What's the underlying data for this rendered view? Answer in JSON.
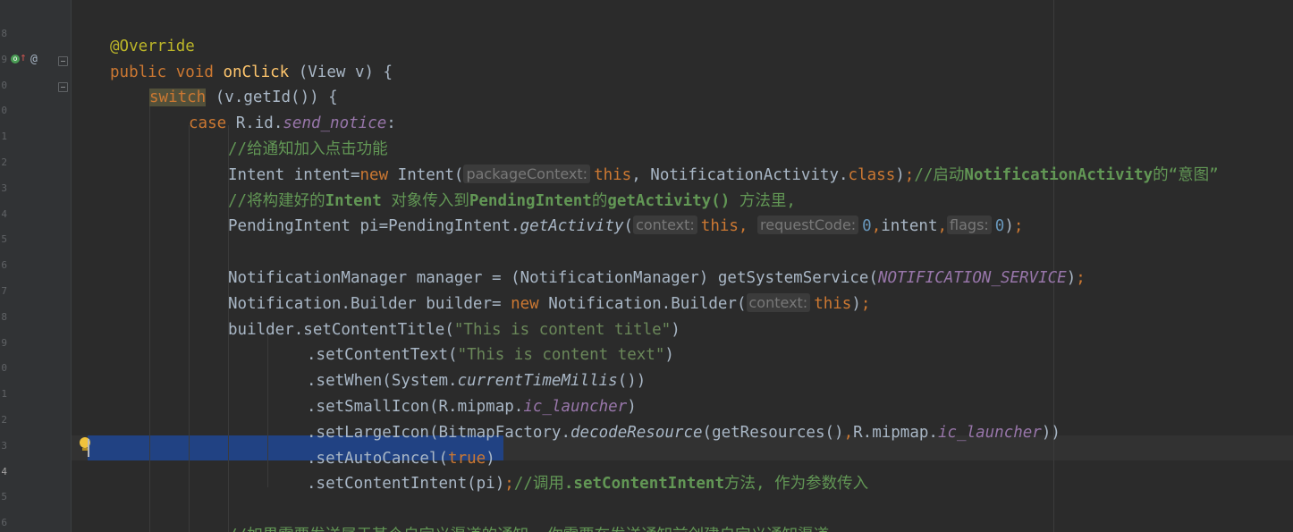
{
  "gutter": {
    "line_numbers": [
      "8",
      "9",
      "0",
      "0",
      "1",
      "2",
      "3",
      "4",
      "5",
      "6",
      "7",
      "8",
      "9",
      "0",
      "1",
      "2",
      "3",
      "4",
      "5",
      "6",
      "7"
    ],
    "override_marker": "o",
    "implements_marker": "↑",
    "annotation_marker": "@",
    "current_line_index": 17
  },
  "code": {
    "lines": [
      {
        "indent": 0,
        "tokens": []
      },
      {
        "indent": 0,
        "tokens": [
          {
            "t": "ann",
            "v": "@Override"
          }
        ]
      },
      {
        "indent": 0,
        "tokens": [
          {
            "t": "kw",
            "v": "public void "
          },
          {
            "t": "fn",
            "v": "onClick"
          },
          {
            "t": "def",
            "v": " (View v) {"
          }
        ]
      },
      {
        "indent": 1,
        "tokens": [
          {
            "t": "kw-switch",
            "v": "switch"
          },
          {
            "t": "def",
            "v": " (v.getId()) {"
          }
        ]
      },
      {
        "indent": 2,
        "tokens": [
          {
            "t": "kw",
            "v": "case "
          },
          {
            "t": "def",
            "v": "R.id."
          },
          {
            "t": "field",
            "v": "send_notice"
          },
          {
            "t": "def",
            "v": ":"
          }
        ]
      },
      {
        "indent": 3,
        "tokens": [
          {
            "t": "cmt",
            "v": "//给通知加入点击功能"
          }
        ]
      },
      {
        "indent": 3,
        "tokens": [
          {
            "t": "def",
            "v": "Intent intent="
          },
          {
            "t": "kw",
            "v": "new "
          },
          {
            "t": "def",
            "v": "Intent("
          },
          {
            "t": "hint",
            "v": "packageContext:"
          },
          {
            "t": "kw",
            "v": "this"
          },
          {
            "t": "def",
            "v": ", NotificationActivity."
          },
          {
            "t": "kw",
            "v": "class"
          },
          {
            "t": "def",
            "v": ")"
          },
          {
            "t": "kw",
            "v": ";"
          },
          {
            "t": "cmt",
            "v": "//启动"
          },
          {
            "t": "cmtb",
            "v": "NotificationActivity"
          },
          {
            "t": "cmt",
            "v": "的“意图”"
          }
        ]
      },
      {
        "indent": 3,
        "tokens": [
          {
            "t": "cmt",
            "v": "//将构建好的"
          },
          {
            "t": "cmtb",
            "v": "Intent"
          },
          {
            "t": "cmt",
            "v": " 对象传入到"
          },
          {
            "t": "cmtb",
            "v": "PendingIntent"
          },
          {
            "t": "cmt",
            "v": "的"
          },
          {
            "t": "cmtb",
            "v": "getActivity()"
          },
          {
            "t": "cmt",
            "v": " 方法里,"
          }
        ]
      },
      {
        "indent": 3,
        "tokens": [
          {
            "t": "def",
            "v": "PendingIntent pi=PendingIntent."
          },
          {
            "t": "static-m",
            "v": "getActivity"
          },
          {
            "t": "def",
            "v": "("
          },
          {
            "t": "hint",
            "v": "context:"
          },
          {
            "t": "kw",
            "v": "this, "
          },
          {
            "t": "hint",
            "v": "requestCode:"
          },
          {
            "t": "num",
            "v": "0"
          },
          {
            "t": "kw",
            "v": ","
          },
          {
            "t": "def",
            "v": "intent"
          },
          {
            "t": "kw",
            "v": ","
          },
          {
            "t": "hint",
            "v": "flags:"
          },
          {
            "t": "num",
            "v": "0"
          },
          {
            "t": "def",
            "v": ")"
          },
          {
            "t": "kw",
            "v": ";"
          }
        ]
      },
      {
        "indent": 3,
        "tokens": []
      },
      {
        "indent": 3,
        "tokens": [
          {
            "t": "def",
            "v": "NotificationManager manager = (NotificationManager) getSystemService("
          },
          {
            "t": "static",
            "v": "NOTIFICATION_SERVICE"
          },
          {
            "t": "def",
            "v": ")"
          },
          {
            "t": "kw",
            "v": ";"
          }
        ]
      },
      {
        "indent": 3,
        "tokens": [
          {
            "t": "def",
            "v": "Notification.Builder builder= "
          },
          {
            "t": "kw",
            "v": "new "
          },
          {
            "t": "def",
            "v": "Notification.Builder("
          },
          {
            "t": "hint",
            "v": "context:"
          },
          {
            "t": "kw",
            "v": "this"
          },
          {
            "t": "def",
            "v": ")"
          },
          {
            "t": "kw",
            "v": ";"
          }
        ]
      },
      {
        "indent": 3,
        "tokens": [
          {
            "t": "def",
            "v": "builder.setContentTitle("
          },
          {
            "t": "str",
            "v": "\"This is content title\""
          },
          {
            "t": "def",
            "v": ")"
          }
        ]
      },
      {
        "indent": 5,
        "tokens": [
          {
            "t": "def",
            "v": ".setContentText("
          },
          {
            "t": "str",
            "v": "\"This is content text\""
          },
          {
            "t": "def",
            "v": ")"
          }
        ]
      },
      {
        "indent": 5,
        "tokens": [
          {
            "t": "def",
            "v": ".setWhen(System."
          },
          {
            "t": "static-m",
            "v": "currentTimeMillis"
          },
          {
            "t": "def",
            "v": "())"
          }
        ]
      },
      {
        "indent": 5,
        "tokens": [
          {
            "t": "def",
            "v": ".setSmallIcon(R.mipmap."
          },
          {
            "t": "field",
            "v": "ic_launcher"
          },
          {
            "t": "def",
            "v": ")"
          }
        ]
      },
      {
        "indent": 5,
        "tokens": [
          {
            "t": "def",
            "v": ".setLargeIcon(BitmapFactory."
          },
          {
            "t": "static-m",
            "v": "decodeResource"
          },
          {
            "t": "def",
            "v": "(getResources()"
          },
          {
            "t": "kw",
            "v": ","
          },
          {
            "t": "def",
            "v": "R.mipmap."
          },
          {
            "t": "field",
            "v": "ic_launcher"
          },
          {
            "t": "def",
            "v": "))"
          }
        ]
      },
      {
        "indent": 5,
        "tokens": [
          {
            "t": "def",
            "v": ".setAutoCancel("
          },
          {
            "t": "kw",
            "v": "true"
          },
          {
            "t": "def",
            "v": ")"
          }
        ]
      },
      {
        "indent": 5,
        "tokens": [
          {
            "t": "def",
            "v": ".setContentIntent(pi)"
          },
          {
            "t": "kw",
            "v": ";"
          },
          {
            "t": "cmt",
            "v": "//调用"
          },
          {
            "t": "cmtb",
            "v": ".setContentIntent"
          },
          {
            "t": "cmt",
            "v": "方法, 作为参数传入"
          }
        ]
      },
      {
        "indent": 3,
        "tokens": []
      },
      {
        "indent": 3,
        "tokens": [
          {
            "t": "cmt",
            "v": "//如果需要发送属于某个自定义渠道的通知, 你需要在发送通知前创建自定义通知渠道"
          }
        ]
      }
    ]
  }
}
